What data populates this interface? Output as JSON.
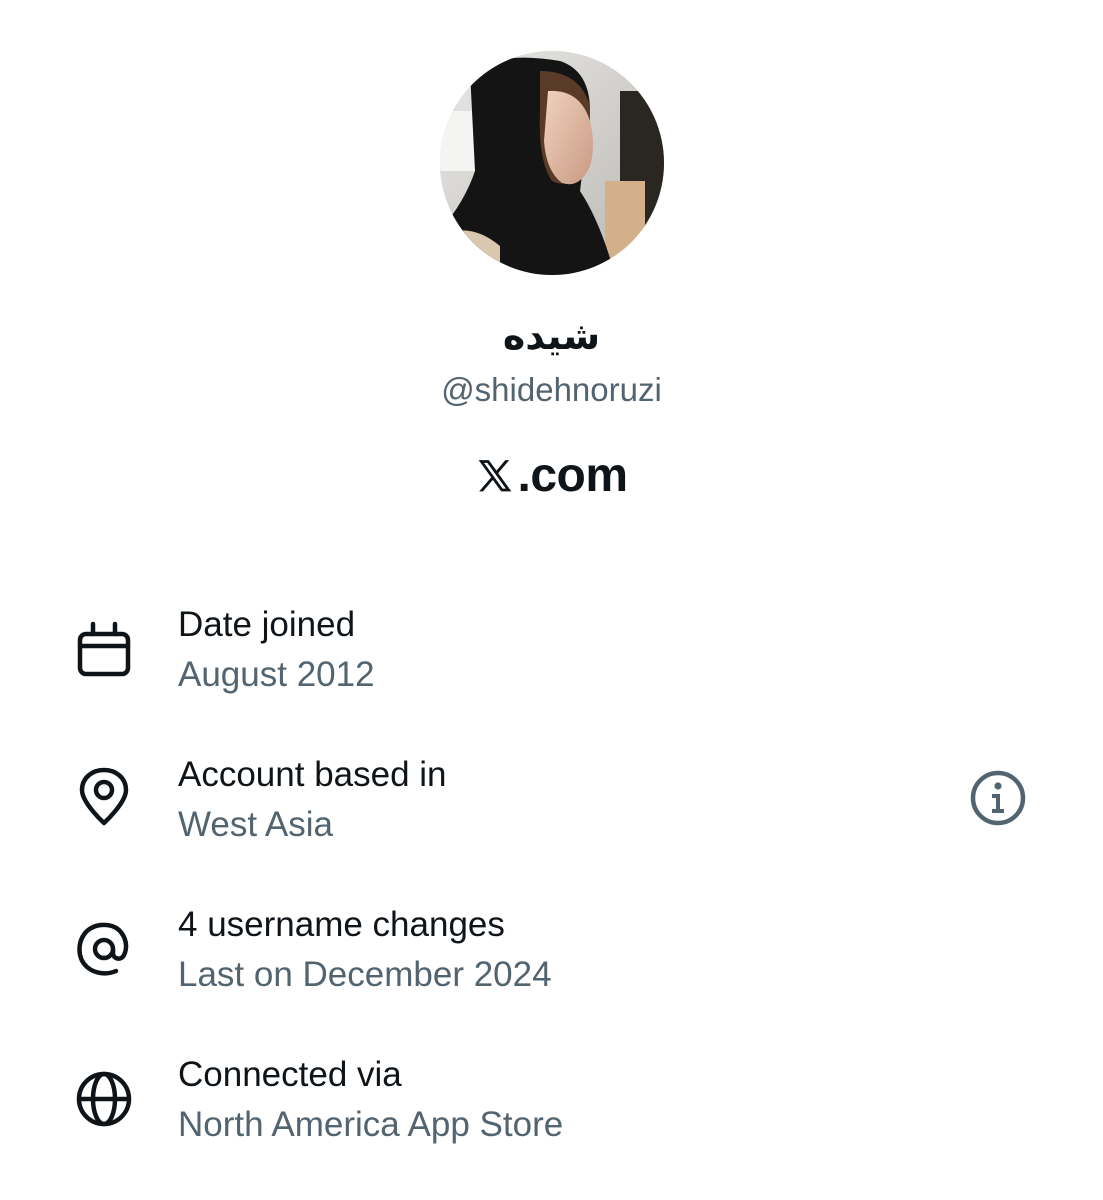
{
  "profile": {
    "display_name": "شیده",
    "handle": "@shidehnoruzi"
  },
  "brand": {
    "text": ".com",
    "logo_icon": "x-logo-icon"
  },
  "about": {
    "items": [
      {
        "icon": "calendar-icon",
        "title": "Date joined",
        "subtitle": "August 2012"
      },
      {
        "icon": "location-pin-icon",
        "title": "Account based in",
        "subtitle": "West Asia",
        "action_icon": "info-icon"
      },
      {
        "icon": "at-sign-icon",
        "title": "4 username changes",
        "subtitle": "Last on December 2024"
      },
      {
        "icon": "globe-icon",
        "title": "Connected via",
        "subtitle": "North America App Store"
      }
    ]
  },
  "colors": {
    "primary_text": "#0f1419",
    "secondary_text": "#536471",
    "background": "#ffffff"
  }
}
